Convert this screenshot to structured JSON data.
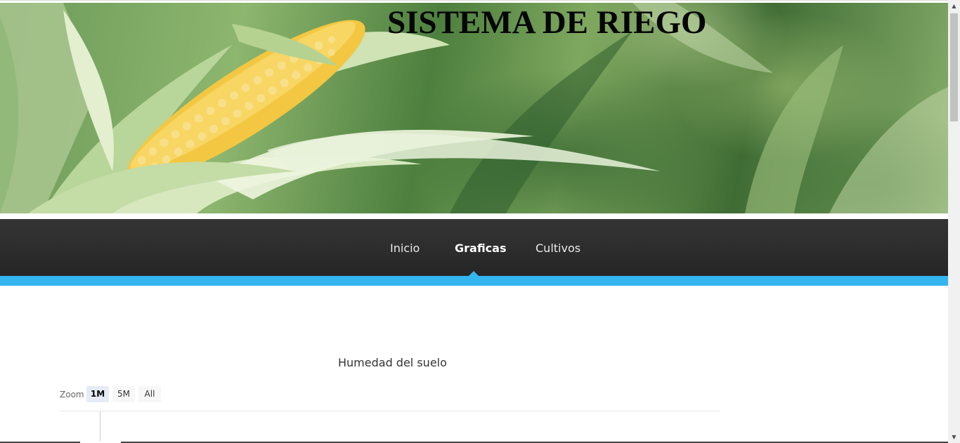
{
  "header": {
    "title": "SISTEMA DE RIEGO",
    "banner_image": "corn-field-photo"
  },
  "nav": {
    "items": [
      {
        "label": "Inicio",
        "active": false
      },
      {
        "label": "Graficas",
        "active": true
      },
      {
        "label": "Cultivos",
        "active": false
      }
    ],
    "accent_color": "#34b5f0"
  },
  "chart": {
    "title": "Humedad del suelo",
    "zoom_label": "Zoom",
    "zoom_options": [
      {
        "label": "1M",
        "selected": true
      },
      {
        "label": "5M",
        "selected": false
      },
      {
        "label": "All",
        "selected": false
      }
    ]
  },
  "scrollbar": {
    "up_icon": "triangle-up-icon",
    "down_icon": "triangle-down-icon"
  }
}
